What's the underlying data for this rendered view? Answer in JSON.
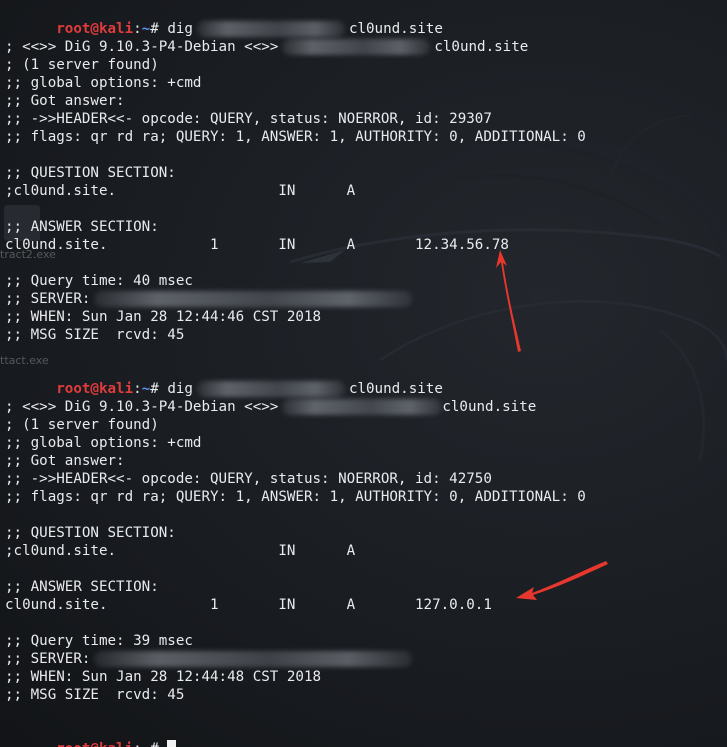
{
  "prompt": {
    "user_host": "root@kali",
    "separator": ":",
    "path": "~",
    "symbol": "# "
  },
  "commands": [
    {
      "cmd": "dig",
      "arg": "cl0und.site"
    },
    {
      "cmd": "dig",
      "arg": "cl0und.site"
    }
  ],
  "outputs": [
    {
      "banner_prefix": "; <<>> DiG 9.10.3-P4-Debian <<>>",
      "banner_domain": "cl0und.site",
      "server_found": "; (1 server found)",
      "global_options": ";; global options: +cmd",
      "got_answer": ";; Got answer:",
      "header": ";; ->>HEADER<<- opcode: QUERY, status: NOERROR, id: 29307",
      "flags": ";; flags: qr rd ra; QUERY: 1, ANSWER: 1, AUTHORITY: 0, ADDITIONAL: 0",
      "question_title": ";; QUESTION SECTION:",
      "question_row": ";cl0und.site.                   IN      A",
      "answer_title": ";; ANSWER SECTION:",
      "answer_row": "cl0und.site.            1       IN      A       12.34.56.78",
      "query_time": ";; Query time: 40 msec",
      "server": ";; SERVER:",
      "when": ";; WHEN: Sun Jan 28 12:44:46 CST 2018",
      "msg_size": ";; MSG SIZE  rcvd: 45"
    },
    {
      "banner_prefix": "; <<>> DiG 9.10.3-P4-Debian <<>>",
      "banner_domain": "cl0und.site",
      "server_found": "; (1 server found)",
      "global_options": ";; global options: +cmd",
      "got_answer": ";; Got answer:",
      "header": ";; ->>HEADER<<- opcode: QUERY, status: NOERROR, id: 42750",
      "flags": ";; flags: qr rd ra; QUERY: 1, ANSWER: 1, AUTHORITY: 0, ADDITIONAL: 0",
      "question_title": ";; QUESTION SECTION:",
      "question_row": ";cl0und.site.                   IN      A",
      "answer_title": ";; ANSWER SECTION:",
      "answer_row": "cl0und.site.            1       IN      A       127.0.0.1",
      "query_time": ";; Query time: 39 msec",
      "server": ";; SERVER:",
      "when": ";; WHEN: Sun Jan 28 12:44:48 CST 2018",
      "msg_size": ";; MSG SIZE  rcvd: 45"
    }
  ],
  "desktop_ghosts": [
    "tract2.exe",
    "ttact.exe"
  ],
  "colors": {
    "background": "#1b1e23",
    "text": "#e9ebee",
    "prompt_user": "#e03c3c",
    "prompt_path": "#5a8ee8",
    "arrow": "#e8382e"
  },
  "icons": {
    "cursor": "block-cursor-icon",
    "arrow": "red-arrow-annotation-icon"
  }
}
